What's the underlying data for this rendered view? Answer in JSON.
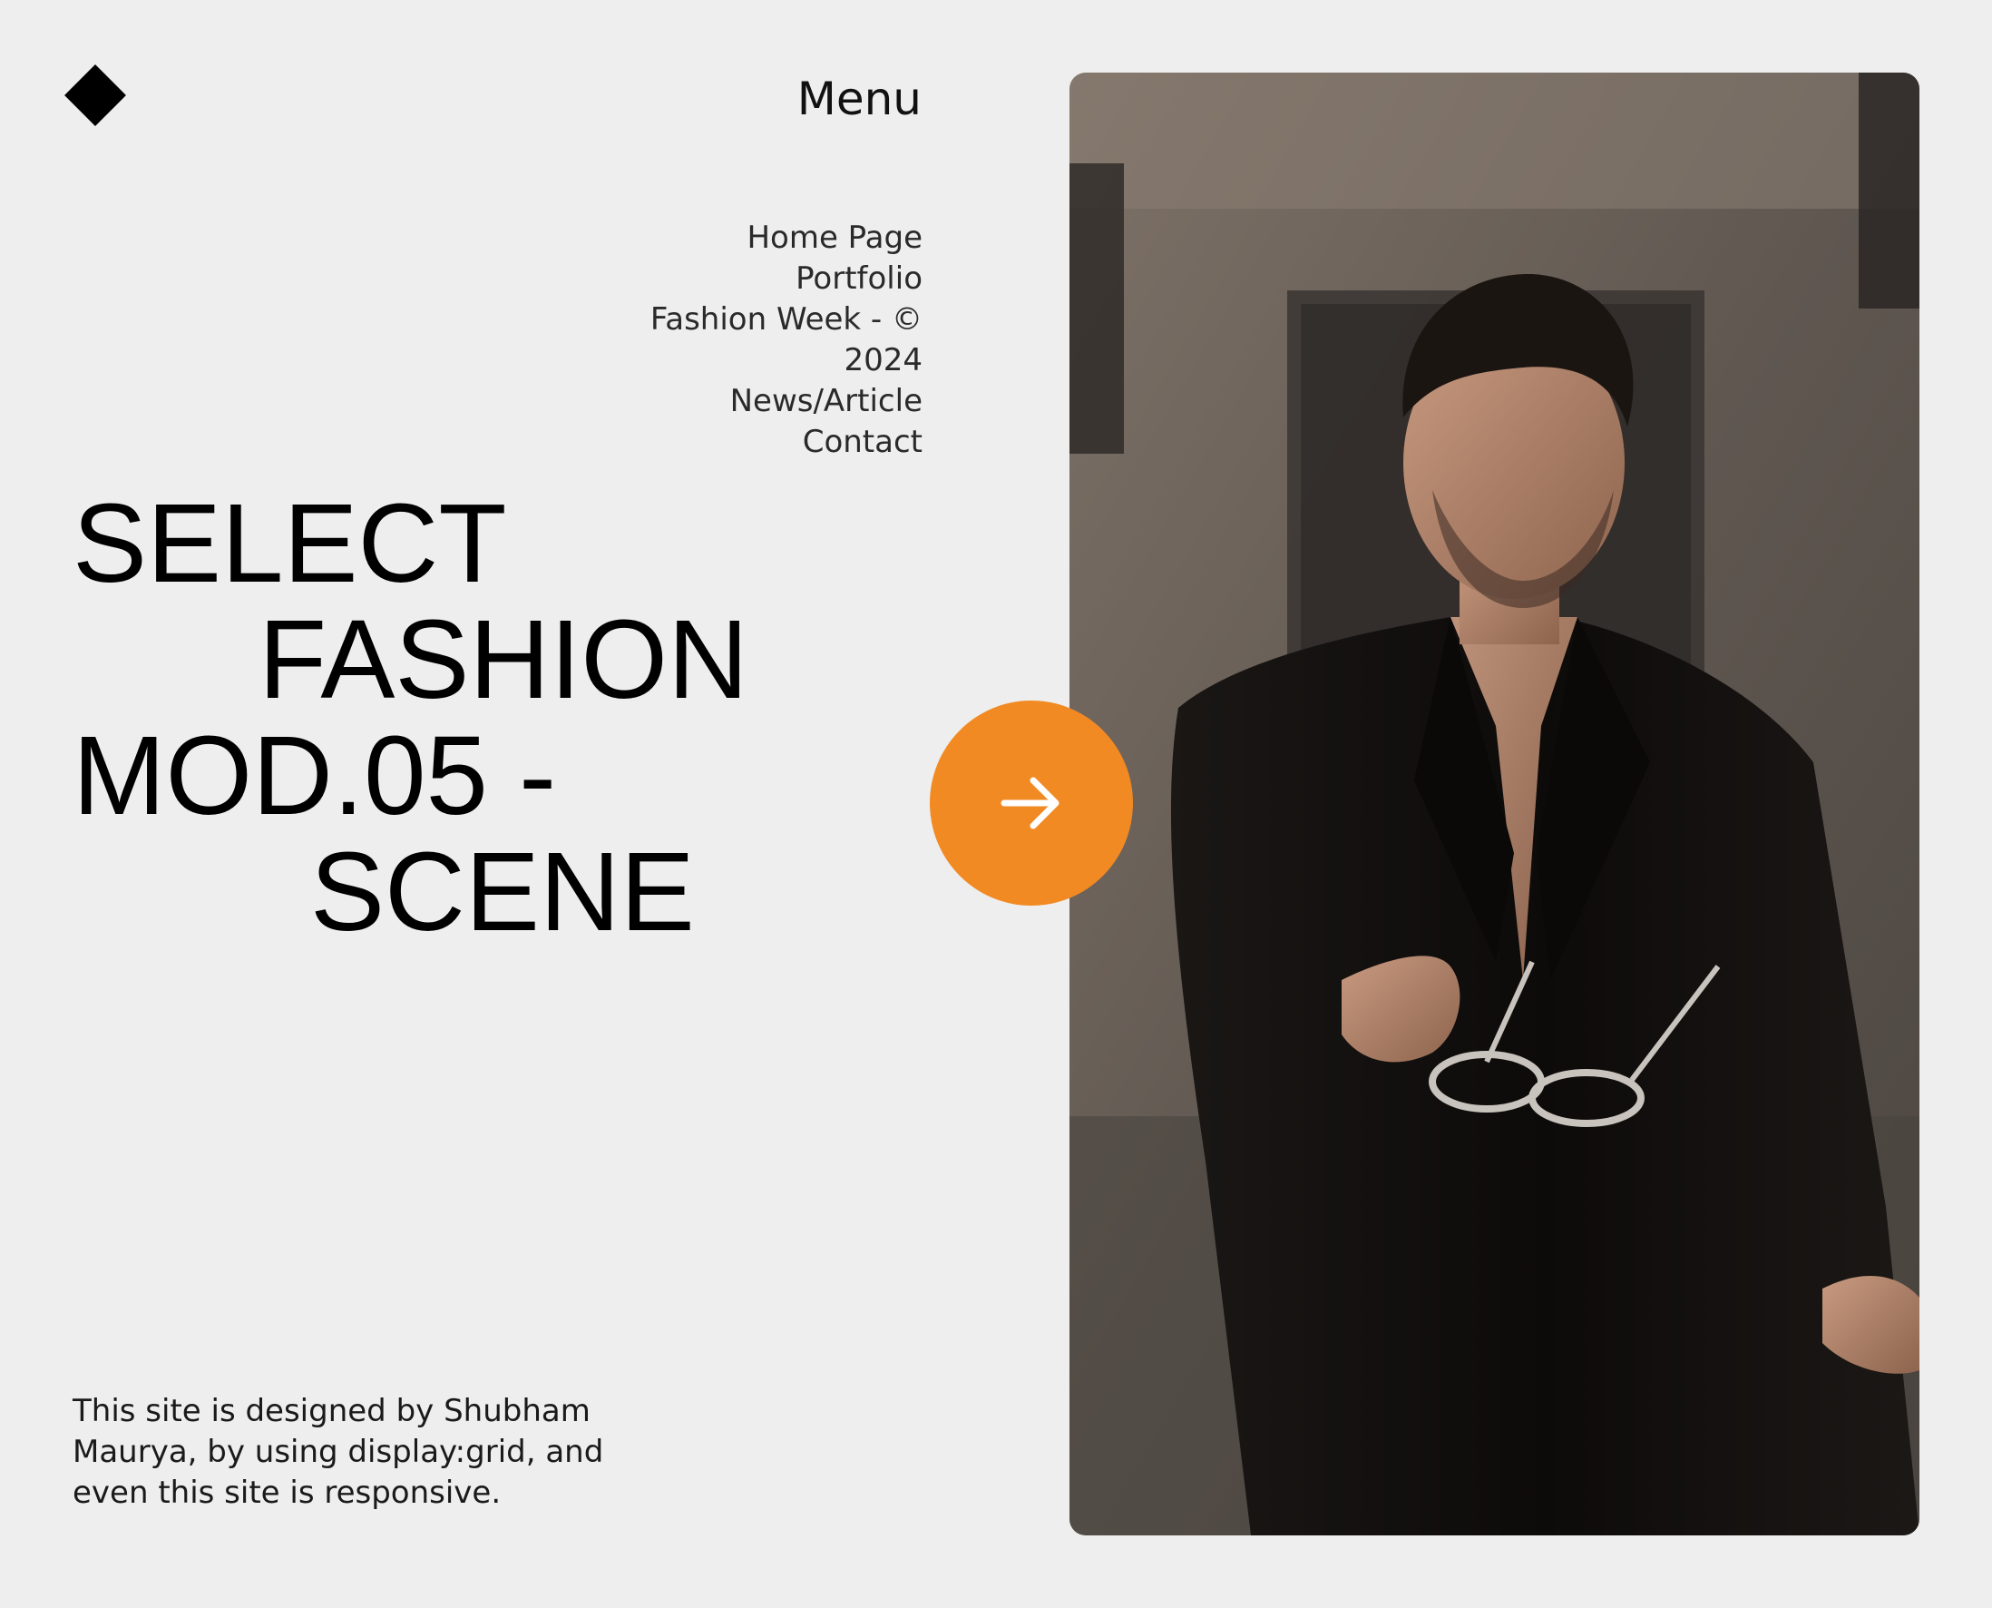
{
  "header": {
    "logo_icon": "diamond-logo-icon",
    "menu_label": "Menu"
  },
  "nav": {
    "items": [
      {
        "label": "Home Page"
      },
      {
        "label": "Portfolio"
      },
      {
        "label": "Fashion Week - © 2024"
      },
      {
        "label": "News/Article"
      },
      {
        "label": "Contact"
      }
    ]
  },
  "hero": {
    "line1": "SELECT",
    "line2": "FASHION",
    "line3": "MOD.05 -",
    "line4": "SCENE"
  },
  "footer": {
    "credit": "This site is designed by Shubham Maurya, by using display:grid, and even this site is responsive."
  },
  "cta": {
    "icon": "arrow-right-icon",
    "color": "#f28a23"
  },
  "colors": {
    "background": "#eeeeee",
    "text": "#111111",
    "accent": "#f28a23"
  }
}
